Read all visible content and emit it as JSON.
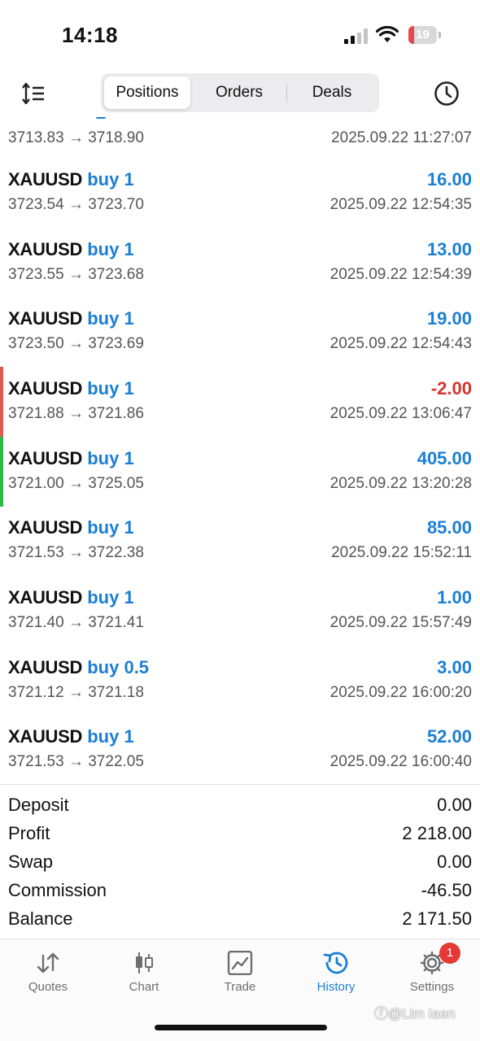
{
  "status_bar": {
    "time": "14:18",
    "battery_level": "19",
    "battery_fraction": 0.19,
    "battery_color": "#e5484d"
  },
  "header": {
    "tabs": [
      {
        "label": "Positions",
        "active": true
      },
      {
        "label": "Orders",
        "active": false
      },
      {
        "label": "Deals",
        "active": false
      }
    ],
    "left_icon": "sort-list-icon",
    "right_icon": "clock-history-icon"
  },
  "partial_row": {
    "prices": "3713.83 → 3718.90",
    "datetime": "2025.09.22 11:27:07"
  },
  "positions": [
    {
      "symbol": "XAUUSD",
      "side": "buy 1",
      "profit": "16.00",
      "prices": "3723.54 → 3723.70",
      "datetime": "2025.09.22 12:54:35"
    },
    {
      "symbol": "XAUUSD",
      "side": "buy 1",
      "profit": "13.00",
      "prices": "3723.55 → 3723.68",
      "datetime": "2025.09.22 12:54:39"
    },
    {
      "symbol": "XAUUSD",
      "side": "buy 1",
      "profit": "19.00",
      "prices": "3723.50 → 3723.69",
      "datetime": "2025.09.22 12:54:43"
    },
    {
      "symbol": "XAUUSD",
      "side": "buy 1",
      "profit": "-2.00",
      "prices": "3721.88 → 3721.86",
      "datetime": "2025.09.22 13:06:47"
    },
    {
      "symbol": "XAUUSD",
      "side": "buy 1",
      "profit": "405.00",
      "prices": "3721.00 → 3725.05",
      "datetime": "2025.09.22 13:20:28"
    },
    {
      "symbol": "XAUUSD",
      "side": "buy 1",
      "profit": "85.00",
      "prices": "3721.53 → 3722.38",
      "datetime": "2025.09.22 15:52:11"
    },
    {
      "symbol": "XAUUSD",
      "side": "buy 1",
      "profit": "1.00",
      "prices": "3721.40 → 3721.41",
      "datetime": "2025.09.22 15:57:49"
    },
    {
      "symbol": "XAUUSD",
      "side": "buy 0.5",
      "profit": "3.00",
      "prices": "3721.12 → 3721.18",
      "datetime": "2025.09.22 16:00:20"
    },
    {
      "symbol": "XAUUSD",
      "side": "buy 1",
      "profit": "52.00",
      "prices": "3721.53 → 3722.05",
      "datetime": "2025.09.22 16:00:40"
    }
  ],
  "summary": {
    "deposit_label": "Deposit",
    "deposit": "0.00",
    "profit_label": "Profit",
    "profit": "2 218.00",
    "swap_label": "Swap",
    "swap": "0.00",
    "commission_label": "Commission",
    "commission": "-46.50",
    "balance_label": "Balance",
    "balance": "2 171.50"
  },
  "tabbar": {
    "items": [
      {
        "label": "Quotes",
        "icon": "quotes-arrows-icon"
      },
      {
        "label": "Chart",
        "icon": "candlestick-icon"
      },
      {
        "label": "Trade",
        "icon": "trade-chart-icon"
      },
      {
        "label": "History",
        "icon": "history-clock-icon",
        "active": true
      },
      {
        "label": "Settings",
        "icon": "gear-icon",
        "badge": "1"
      }
    ]
  },
  "watermark": "ⓕ@Lim Iaen",
  "colors": {
    "accent_blue": "#1a7fd4",
    "loss_red": "#d5352b",
    "marker_red": "#e05a52",
    "marker_green": "#2db84a",
    "badge_red": "#e53935"
  }
}
